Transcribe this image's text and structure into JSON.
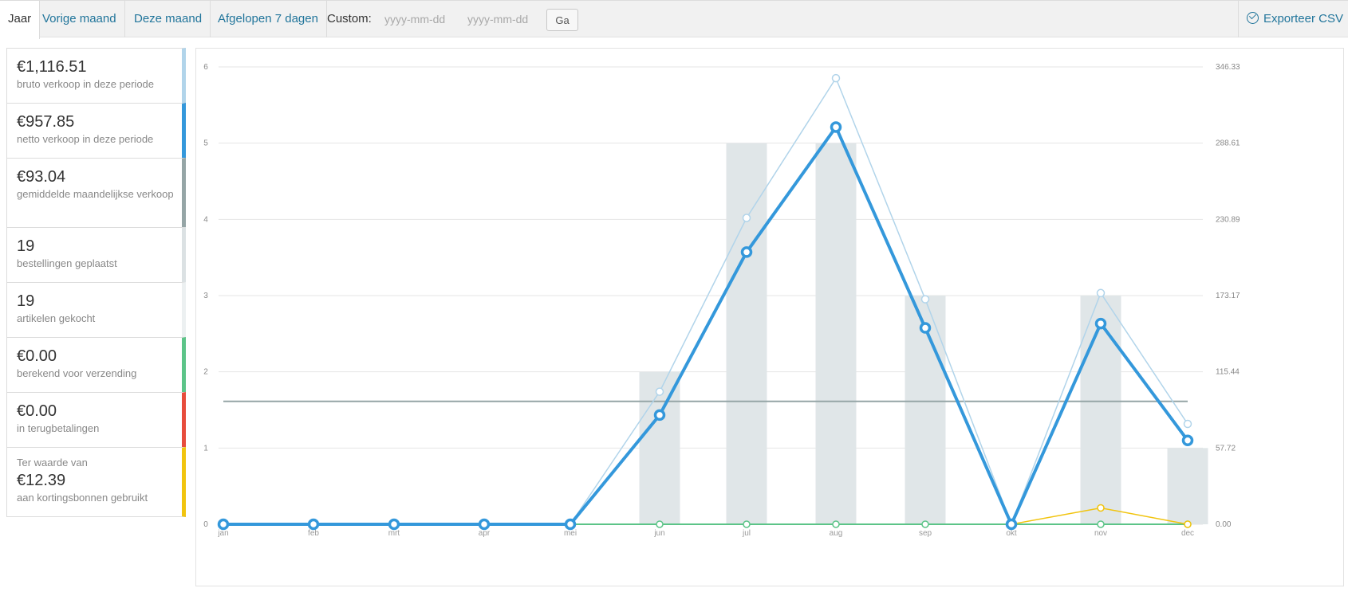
{
  "nav": {
    "tabs": [
      {
        "label": "Jaar",
        "active": true
      },
      {
        "label": "Vorige maand",
        "active": false
      },
      {
        "label": "Deze maand",
        "active": false
      },
      {
        "label": "Afgelopen 7 dagen",
        "active": false
      }
    ],
    "custom_label": "Custom:",
    "start_placeholder": "yyyy-mm-dd",
    "end_placeholder": "yyyy-mm-dd",
    "go_label": "Ga",
    "export_label": "Exporteer CSV",
    "export_icon": "download-icon"
  },
  "legend": [
    {
      "amount": "€1,116.51",
      "desc": "bruto verkoop in deze periode",
      "color": "#b1d4ea"
    },
    {
      "amount": "€957.85",
      "desc": "netto verkoop in deze periode",
      "color": "#3498db"
    },
    {
      "amount": "€93.04",
      "desc": "gemiddelde maandelijkse verkoop",
      "color": "#95a5a6"
    },
    {
      "amount": "19",
      "desc": "bestellingen geplaatst",
      "color": "#dbe1e3"
    },
    {
      "amount": "19",
      "desc": "artikelen gekocht",
      "color": "#ecf0f1"
    },
    {
      "amount": "€0.00",
      "desc": "berekend voor verzending",
      "color": "#5cc488"
    },
    {
      "amount": "€0.00",
      "desc": "in terugbetalingen",
      "color": "#e74c3c"
    },
    {
      "pre": "Ter waarde van",
      "amount": "€12.39",
      "desc": "aan kortingsbonnen gebruikt",
      "color": "#f1c40f"
    }
  ],
  "chart_data": {
    "type": "bar",
    "categories": [
      "jan",
      "feb",
      "mrt",
      "apr",
      "mei",
      "jun",
      "jul",
      "aug",
      "sep",
      "okt",
      "nov",
      "dec"
    ],
    "left_axis": {
      "ticks": [
        "0",
        "1",
        "2",
        "3",
        "4",
        "5",
        "6"
      ],
      "ylim": [
        0,
        6
      ]
    },
    "right_axis": {
      "ticks": [
        "0.00",
        "57.72",
        "115.44",
        "173.17",
        "230.89",
        "288.61",
        "346.33"
      ],
      "ylim": [
        0,
        346.33
      ]
    },
    "grid": true,
    "series": [
      {
        "values": [
          0,
          0,
          0,
          0,
          0,
          2,
          5,
          5,
          3,
          0,
          3,
          1
        ],
        "kind": "bar",
        "axis": "left",
        "color": "#dbe1e3"
      },
      {
        "values": [
          0,
          0,
          0,
          0,
          0,
          2,
          5,
          5,
          3,
          0,
          3,
          1
        ],
        "kind": "bar",
        "axis": "left",
        "color": "#ecf0f1"
      },
      {
        "values": [
          0,
          0,
          0,
          0,
          0,
          100.4,
          232.0,
          337.8,
          170.4,
          0,
          175.1,
          76.0
        ],
        "kind": "line",
        "axis": "right",
        "color": "#b1d4ea"
      },
      {
        "values": [
          0,
          0,
          0,
          0,
          0,
          82.7,
          206.1,
          300.8,
          148.7,
          0,
          152.0,
          63.5
        ],
        "kind": "line",
        "axis": "right",
        "color": "#3498db"
      },
      {
        "values": [
          0,
          0,
          0,
          0,
          0,
          0,
          0,
          0,
          0,
          0,
          0,
          0
        ],
        "kind": "line",
        "axis": "right",
        "color": "#5cc488"
      },
      {
        "values": [
          null,
          null,
          null,
          null,
          null,
          null,
          null,
          null,
          null,
          0,
          12.39,
          0
        ],
        "kind": "line",
        "axis": "right",
        "color": "#f1c40f"
      },
      {
        "values": [
          93.04,
          93.04,
          93.04,
          93.04,
          93.04,
          93.04,
          93.04,
          93.04,
          93.04,
          93.04,
          93.04,
          93.04
        ],
        "kind": "line",
        "axis": "right",
        "color": "#95a5a6"
      }
    ]
  }
}
